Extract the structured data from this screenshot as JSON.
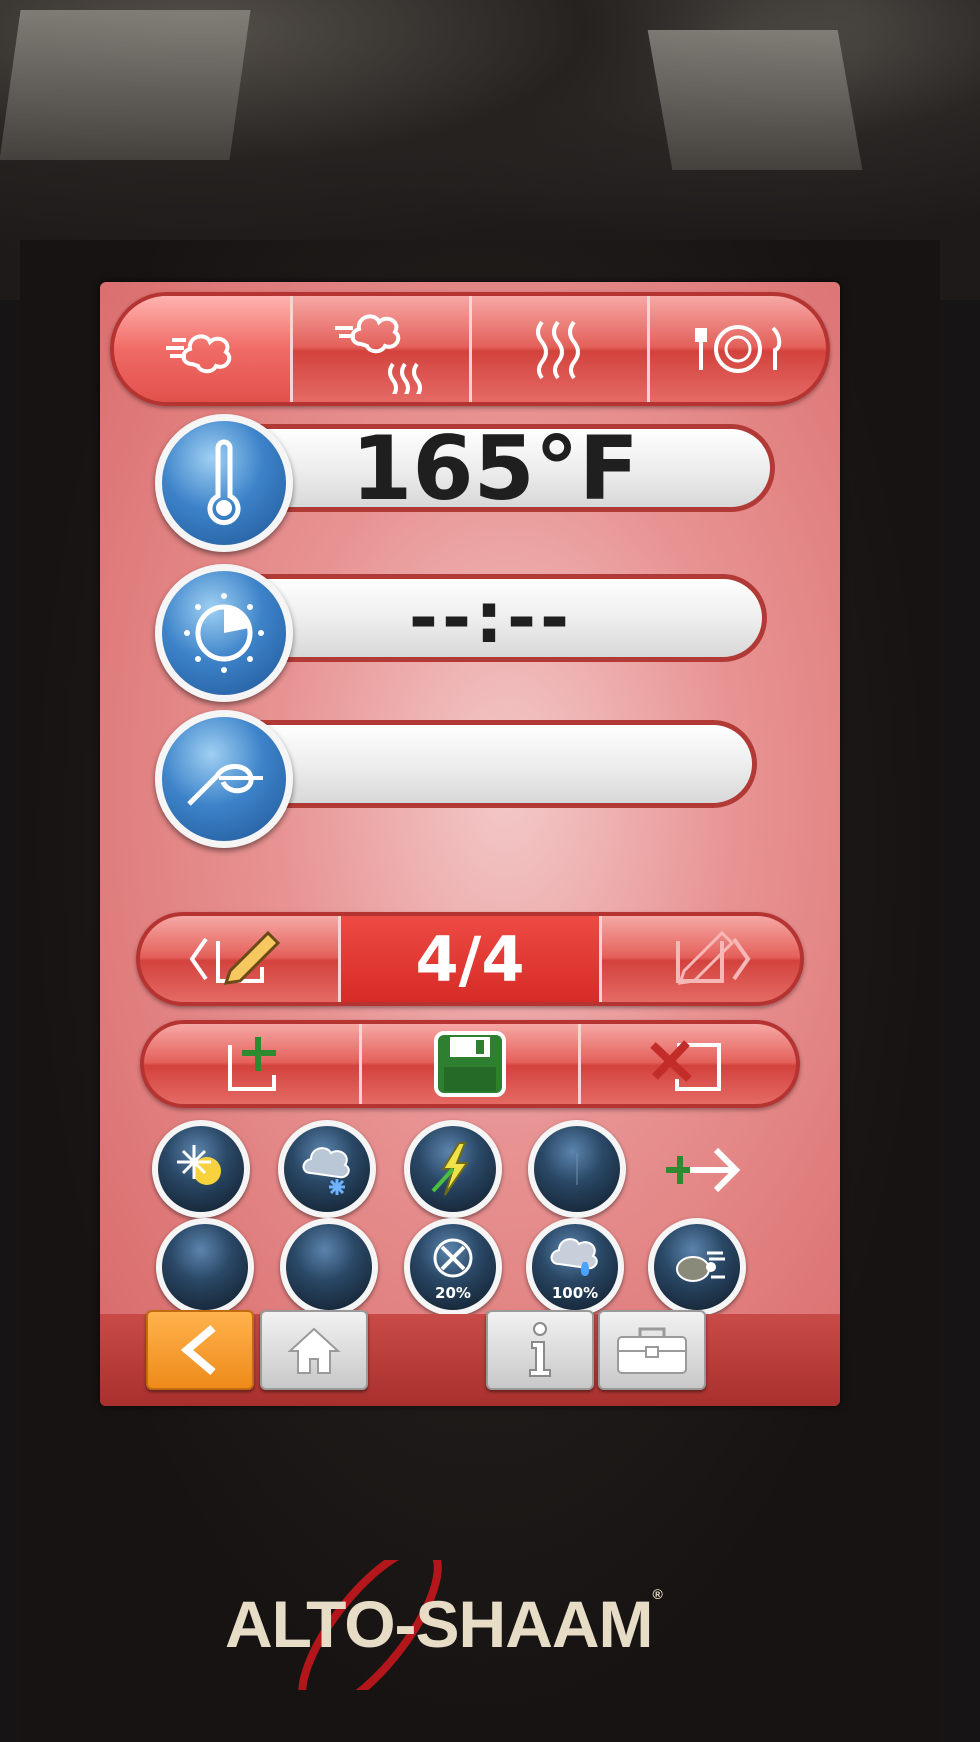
{
  "modes": [
    {
      "name": "convection-icon"
    },
    {
      "name": "combination-icon"
    },
    {
      "name": "steam-icon"
    },
    {
      "name": "retherm-icon"
    }
  ],
  "temperature": {
    "value": "165°F",
    "icon": "thermometer-icon"
  },
  "timer": {
    "value": "--:--",
    "icon": "timer-dial-icon"
  },
  "probe": {
    "value": "",
    "icon": "probe-icon"
  },
  "pager": {
    "label": "4/4"
  },
  "options_row1": [
    {
      "name": "ecosmoke-sun-snow-icon"
    },
    {
      "name": "cloud-snow-icon"
    },
    {
      "name": "lightning-icon"
    },
    {
      "name": "blank-option-icon"
    },
    {
      "name": "add-next-arrow-icon"
    }
  ],
  "options_row2": [
    {
      "name": "blank-option-icon"
    },
    {
      "name": "blank-option-icon"
    },
    {
      "name": "fan-speed-20-icon",
      "label": "20%"
    },
    {
      "name": "humidity-100-icon",
      "label": "100%"
    },
    {
      "name": "delta-t-turtle-icon"
    }
  ],
  "brand": {
    "name": "ALTO-SHAAM",
    "reg": "®"
  },
  "colors": {
    "accent_red": "#d3423d",
    "knob_blue": "#3d83c9",
    "back_orange": "#ee8a1a"
  }
}
